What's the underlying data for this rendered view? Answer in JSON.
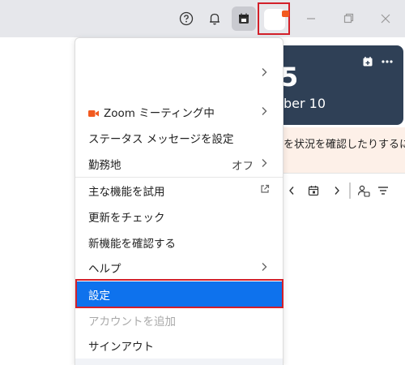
{
  "colors": {
    "accent": "#0e72ed",
    "highlight_border": "#d3202a",
    "zoom_orange": "#f25a1f",
    "dark_card": "#2f4056"
  },
  "titlebar": {
    "icons": [
      "help-icon",
      "bell-icon",
      "calendar-app-icon",
      "avatar",
      "minimize-icon",
      "maximize-icon",
      "close-icon"
    ]
  },
  "background": {
    "card_big_text": "5",
    "card_date_text": "ber 10",
    "notice_text": "を状況を確認したりするに"
  },
  "menu": {
    "zoom_meeting_label": "Zoom ミーティング中",
    "status_message_label": "ステータス メッセージを設定",
    "work_location_label": "勤務地",
    "work_location_value": "オフ",
    "try_features_label": "主な機能を試用",
    "check_updates_label": "更新をチェック",
    "new_features_label": "新機能を確認する",
    "help_label": "ヘルプ",
    "settings_label": "設定",
    "add_account_label": "アカウントを追加",
    "sign_out_label": "サインアウト"
  }
}
